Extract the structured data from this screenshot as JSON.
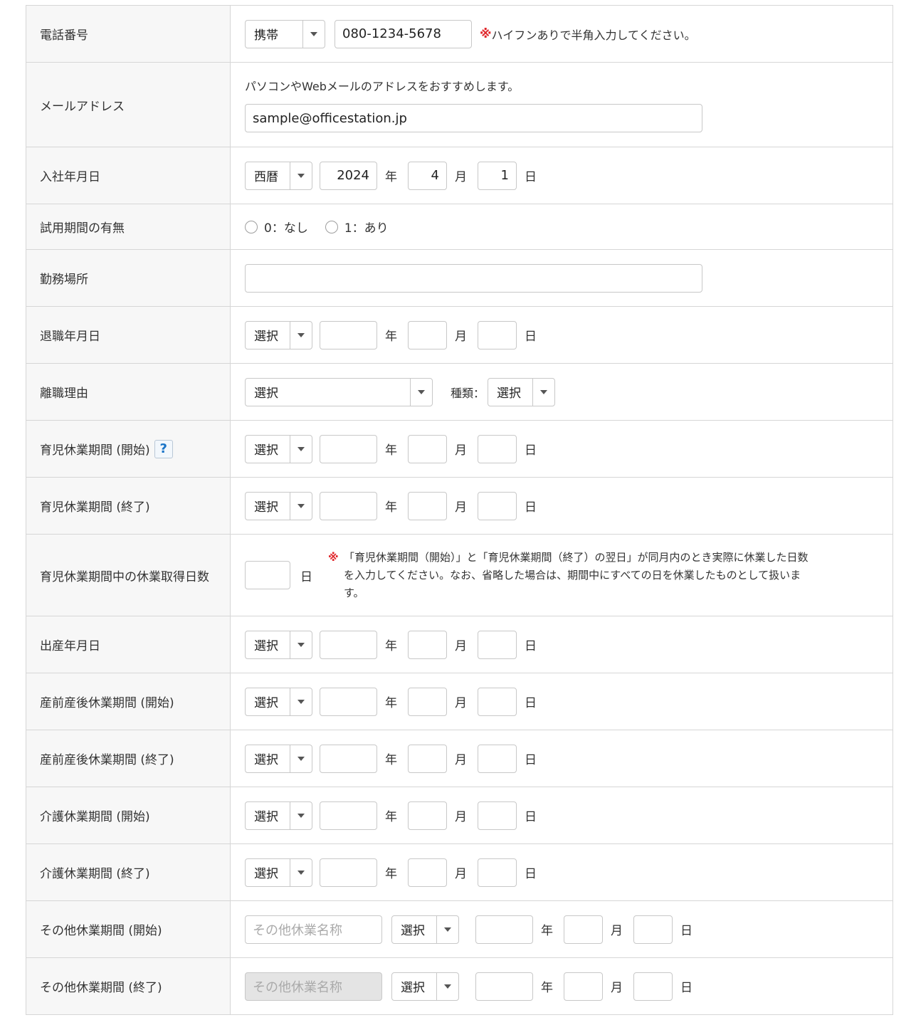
{
  "rows": {
    "phone": {
      "label": "電話番号",
      "type_select": "携帯",
      "number": "080-1234-5678",
      "note_mark": "※",
      "note": "ハイフンありで半角入力してください。"
    },
    "email": {
      "label": "メールアドレス",
      "hint": "パソコンやWebメールのアドレスをおすすめします。",
      "value": "sample@officestation.jp"
    },
    "hire_date": {
      "label": "入社年月日",
      "era": "西暦",
      "year": "2024",
      "month": "4",
      "day": "1"
    },
    "trial": {
      "label": "試用期間の有無",
      "options": [
        "0：なし",
        "1：あり"
      ]
    },
    "workplace": {
      "label": "勤務場所",
      "value": ""
    },
    "retire_date": {
      "label": "退職年月日",
      "era": "選択"
    },
    "retire_reason": {
      "label": "離職理由",
      "reason_select": "選択",
      "kind_label": "種類：",
      "kind_select": "選択"
    },
    "childcare_start": {
      "label": "育児休業期間 (開始)",
      "help": "?",
      "era": "選択"
    },
    "childcare_end": {
      "label": "育児休業期間 (終了)",
      "era": "選択"
    },
    "childcare_days": {
      "label": "育児休業期間中の休業取得日数",
      "unit_day": "日",
      "note_mark": "※",
      "note_lines": [
        "「育児休業期間（開始）」と「育児休業期間（終了）の翌日」が同月内のとき実際に休業した日数",
        "を入力してください。なお、省略した場合は、期間中にすべての日を休業したものとして扱いま",
        "す。"
      ]
    },
    "birth_date": {
      "label": "出産年月日",
      "era": "選択"
    },
    "maternity_start": {
      "label": "産前産後休業期間 (開始)",
      "era": "選択"
    },
    "maternity_end": {
      "label": "産前産後休業期間 (終了)",
      "era": "選択"
    },
    "care_start": {
      "label": "介護休業期間 (開始)",
      "era": "選択"
    },
    "care_end": {
      "label": "介護休業期間 (終了)",
      "era": "選択"
    },
    "other_start": {
      "label": "その他休業期間 (開始)",
      "name_placeholder": "その他休業名称",
      "era": "選択"
    },
    "other_end": {
      "label": "その他休業期間 (終了)",
      "name_placeholder": "その他休業名称",
      "era": "選択"
    }
  },
  "units": {
    "year": "年",
    "month": "月",
    "day": "日"
  },
  "colors": {
    "border": "#d6d6d6",
    "label_bg": "#f7f7f7",
    "note_mark": "#e0272b",
    "help_icon": "#1a74c7"
  }
}
